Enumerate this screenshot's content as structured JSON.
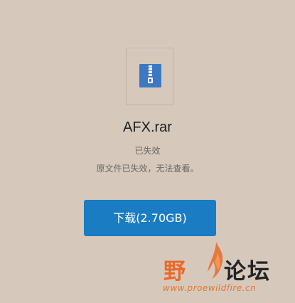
{
  "file": {
    "name": "AFX.rar",
    "icon": "zip-file-icon",
    "status": "已失效",
    "description": "原文件已失效，无法查看。"
  },
  "download": {
    "label": "下载(2.70GB)"
  },
  "watermark": {
    "text_left": "野",
    "text_right": "论坛",
    "url": "www.proewildfire.cn"
  },
  "colors": {
    "background": "#d6c9bc",
    "button": "#1a7cc3",
    "file_icon": "#3d78c4",
    "watermark_orange": "#e86a2a"
  }
}
